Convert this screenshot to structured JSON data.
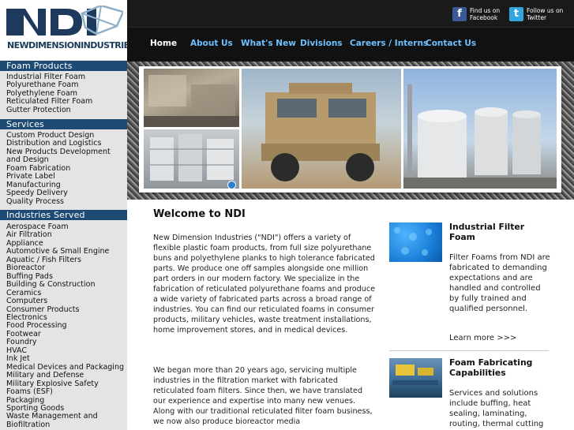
{
  "logo": {
    "text": "NEWDIMENSIONINDUSTRIESLLC"
  },
  "social": {
    "facebook": {
      "line1": "Find us on",
      "line2": "Facebook"
    },
    "twitter": {
      "line1": "Follow us on",
      "line2": "Twitter"
    }
  },
  "nav": [
    "Home",
    "About Us",
    "What's New",
    "Divisions",
    "Careers / Interns",
    "Contact Us"
  ],
  "sidebar": {
    "foam_products": {
      "title": "Foam Products",
      "items": [
        "Industrial Filter Foam",
        "Polyurethane Foam",
        "Polyethylene Foam",
        "Reticulated Filter Foam",
        "Gutter Protection"
      ]
    },
    "services": {
      "title": "Services",
      "items": [
        "Custom Product Design",
        "Distribution and Logistics",
        "New Products Development and Design",
        "Foam Fabrication",
        "Private Label",
        "Manufacturing",
        "Speedy Delivery",
        "Quality Process"
      ]
    },
    "industries": {
      "title": "Industries Served",
      "items": [
        "Aerospace Foam",
        "Air Filtration",
        "Appliance",
        "Automotive & Small Engine",
        "Aquatic / Fish Filters",
        "Bioreactor",
        "Buffing Pads",
        "Building & Construction",
        "Ceramics",
        "Computers",
        "Consumer Products",
        "Electronics",
        "Food Processing",
        "Footwear",
        "Foundry",
        "HVAC",
        "Ink Jet",
        "Medical Devices and Packaging",
        "Military and Defense",
        "Military Explosive Safety Foams (ESF)",
        "Packaging",
        "Sporting Goods",
        "Waste Management and Biofiltration"
      ]
    }
  },
  "main": {
    "title": "Welcome to NDI",
    "paragraph1": "New Dimension Industries (\"NDI\") offers a variety of flexible plastic foam products, from full size polyurethane buns and polyethylene planks to high tolerance fabricated parts. We produce one off samples alongside one million part orders in our modern factory. We specialize in the fabrication of reticulated polyurethane foams and produce a wide variety of fabricated parts across a broad range of industries. You can find our reticulated foams in consumer products, military vehicles, waste treatment installations, home improvement stores, and in medical devices.",
    "paragraph2": "We began more than 20 years ago, servicing multiple industries in the filtration market with fabricated reticulated foam filters. Since then, we have translated our experience and expertise into many new venues. Along with our traditional reticulated filter foam business, we now also produce bioreactor media"
  },
  "features": [
    {
      "title": "Industrial Filter Foam",
      "text": "Filter Foams from NDI are fabricated to demanding expectations and are handled and controlled by fully trained and qualified personnel.",
      "link": "Learn more >>>"
    },
    {
      "title": "Foam Fabricating Capabilities",
      "text": "Services and solutions include buffing, heat sealing, laminating, routing, thermal cutting"
    }
  ],
  "colors": {
    "header_bg": "#141414",
    "nav_link": "#6ec0ff",
    "section_head": "#1e4b73",
    "sidebar_bg": "#e4e4e4"
  }
}
